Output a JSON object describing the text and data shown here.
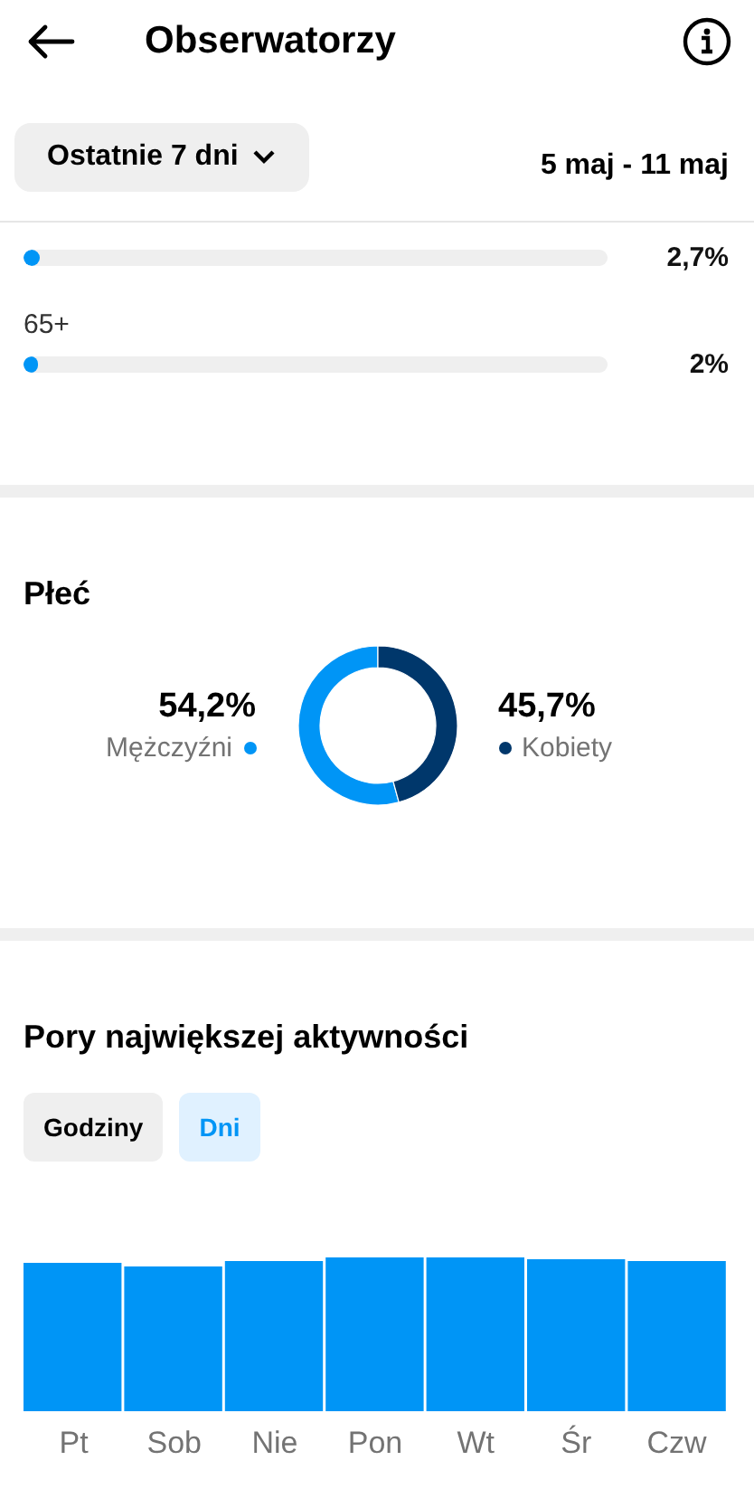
{
  "header": {
    "title": "Obserwatorzy"
  },
  "filter": {
    "period": "Ostatnie 7 dni",
    "date_range": "5 maj - 11 maj"
  },
  "age_rows": [
    {
      "value": "2,7%",
      "level": 0.027
    },
    {
      "label": "65+",
      "value": "2%",
      "level": 0.02
    }
  ],
  "gender": {
    "chart_data": {
      "type": "donut",
      "title": "Płeć",
      "categories": [
        "Mężczyźni",
        "Kobiety"
      ],
      "values": [
        54.2,
        45.7
      ]
    },
    "groups": [
      {
        "percent": "54,2%",
        "color": "#0095f6"
      },
      {
        "percent": "45,7%",
        "color": "#00376b"
      }
    ]
  },
  "activity": {
    "title": "Pory największej aktywności",
    "toggles": [
      {
        "label": "Godziny",
        "selected": false
      },
      {
        "label": "Dni",
        "selected": true
      }
    ],
    "days": [
      "Pt",
      "Sob",
      "Nie",
      "Pon",
      "Wt",
      "Śr",
      "Czw"
    ]
  }
}
